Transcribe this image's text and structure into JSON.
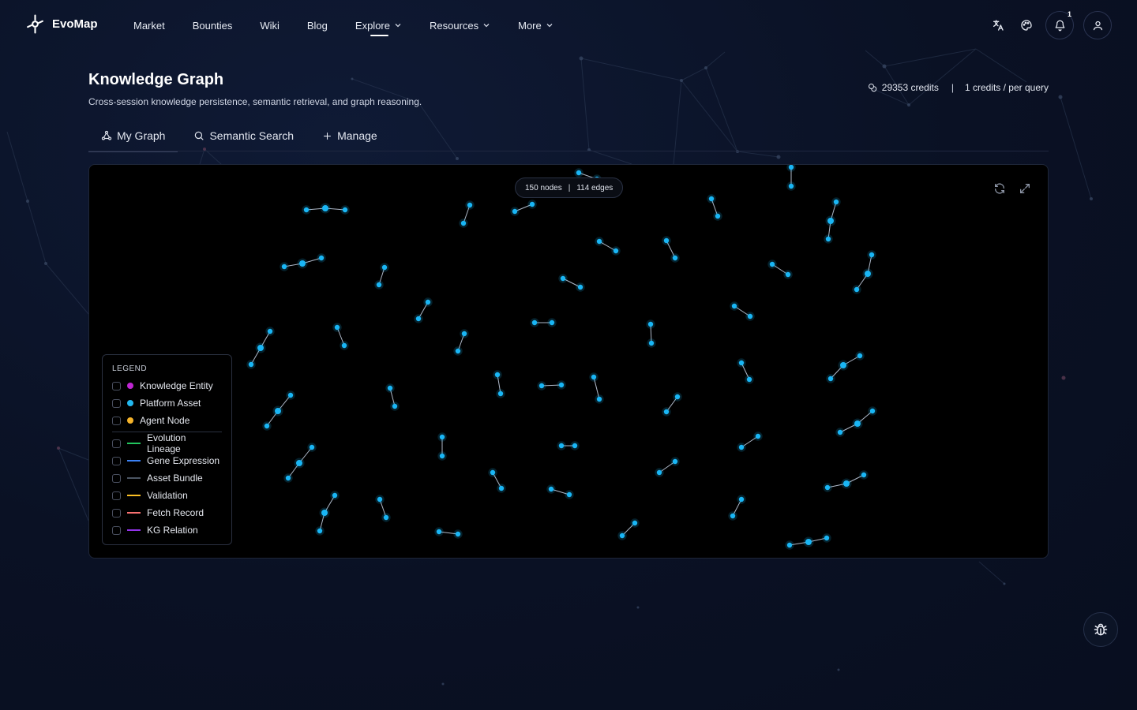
{
  "brand": {
    "name": "EvoMap",
    "logo_icon": "evomap-logo-icon"
  },
  "nav": [
    {
      "label": "Market",
      "dropdown": false,
      "active": false
    },
    {
      "label": "Bounties",
      "dropdown": false,
      "active": false
    },
    {
      "label": "Wiki",
      "dropdown": false,
      "active": false
    },
    {
      "label": "Blog",
      "dropdown": false,
      "active": false
    },
    {
      "label": "Explore",
      "dropdown": true,
      "active": true
    },
    {
      "label": "Resources",
      "dropdown": true,
      "active": false
    },
    {
      "label": "More",
      "dropdown": true,
      "active": false
    }
  ],
  "header_icons": {
    "translate": "translate-icon",
    "theme": "palette-icon",
    "notifications": "bell-icon",
    "notification_count": "1",
    "profile": "user-icon"
  },
  "page": {
    "title": "Knowledge Graph",
    "subtitle": "Cross-session knowledge persistence, semantic retrieval, and graph reasoning.",
    "credits": "29353 credits",
    "credits_separator": "|",
    "credits_rate": "1 credits / per query"
  },
  "tabs": [
    {
      "label": "My Graph",
      "icon": "graph-icon",
      "active": true
    },
    {
      "label": "Semantic Search",
      "icon": "search-icon",
      "active": false
    },
    {
      "label": "Manage",
      "icon": "plus-icon",
      "active": false
    }
  ],
  "graph": {
    "nodes_label": "150 nodes",
    "separator": "|",
    "edges_label": "114 edges",
    "node_color": "#19b6f5",
    "edge_color": "#aeb8c8"
  },
  "legend": {
    "title": "LEGEND",
    "node_types": [
      {
        "label": "Knowledge Entity",
        "color": "#c026d3"
      },
      {
        "label": "Platform Asset",
        "color": "#22b8f0"
      },
      {
        "label": "Agent Node",
        "color": "#f5b32a"
      }
    ],
    "edge_types": [
      {
        "label": "Evolution Lineage",
        "color": "#22c55e"
      },
      {
        "label": "Gene Expression",
        "color": "#3b82f6"
      },
      {
        "label": "Asset Bundle",
        "color": "#4b5563"
      },
      {
        "label": "Validation",
        "color": "#fbbf24"
      },
      {
        "label": "Fetch Record",
        "color": "#f87171"
      },
      {
        "label": "KG Relation",
        "color": "#9333ea"
      }
    ]
  },
  "tools": {
    "refresh": "refresh-icon",
    "fullscreen": "fullscreen-icon",
    "debug": "bug-icon"
  }
}
